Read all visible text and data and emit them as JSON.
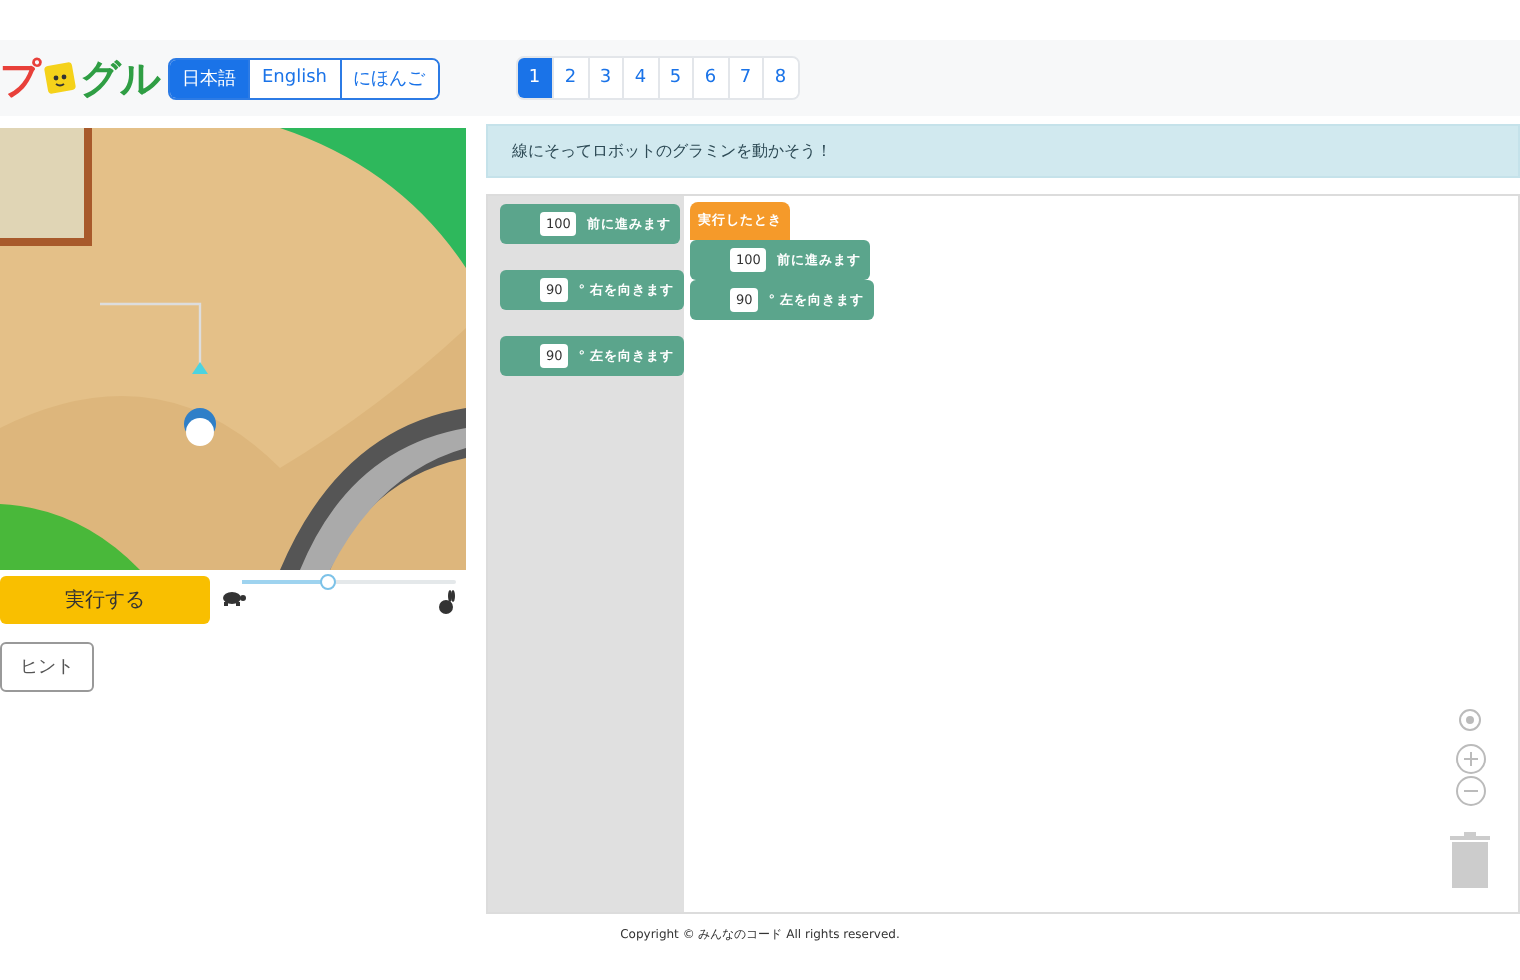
{
  "logo": {
    "parts": [
      "プ",
      "グル"
    ]
  },
  "languages": [
    {
      "label": "日本語",
      "selected": true
    },
    {
      "label": "English",
      "selected": false
    },
    {
      "label": "にほんご",
      "selected": false
    }
  ],
  "levels": [
    {
      "label": "1",
      "selected": true
    },
    {
      "label": "2",
      "selected": false
    },
    {
      "label": "3",
      "selected": false
    },
    {
      "label": "4",
      "selected": false
    },
    {
      "label": "5",
      "selected": false
    },
    {
      "label": "6",
      "selected": false
    },
    {
      "label": "7",
      "selected": false
    },
    {
      "label": "8",
      "selected": false
    }
  ],
  "run_button": "実行する",
  "speed": {
    "level": 0.4
  },
  "hint_button": "ヒント",
  "instruction": "線にそってロボットのグラミンを動かそう！",
  "toolbox": [
    {
      "value": "100",
      "label": "前に進みます"
    },
    {
      "value": "90",
      "label": "° 右を向きます"
    },
    {
      "value": "90",
      "label": "° 左を向きます"
    }
  ],
  "workspace": {
    "hat": "実行したとき",
    "blocks": [
      {
        "value": "100",
        "label": "前に進みます"
      },
      {
        "value": "90",
        "label": "° 左を向きます"
      }
    ]
  },
  "footer": "Copyright © みんなのコード All rights reserved."
}
